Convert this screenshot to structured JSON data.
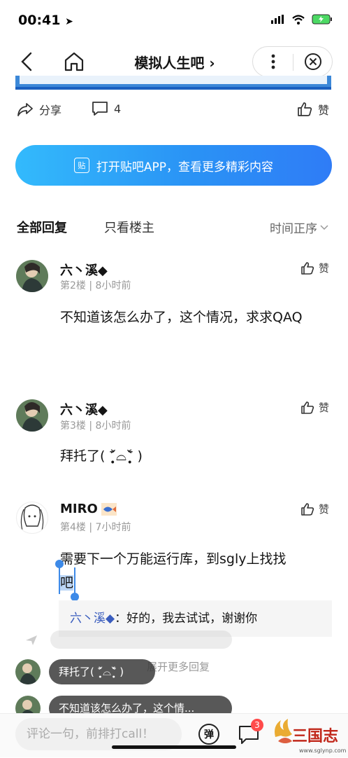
{
  "status_bar": {
    "time": "00:41"
  },
  "header": {
    "title": "模拟人生吧 ›"
  },
  "post_actions": {
    "share_label": "分享",
    "comment_count": "4",
    "like_label": "赞"
  },
  "banner": {
    "icon_text": "贴",
    "text": "打开贴吧APP，查看更多精彩内容"
  },
  "tabs": {
    "all": "全部回复",
    "op_only": "只看楼主",
    "sort": "时间正序"
  },
  "replies": [
    {
      "name": "六丶溪◆",
      "floor": "第2楼",
      "time": "8小时前",
      "content": "不知道该怎么办了，这个情况，求求QAQ",
      "like": "赞"
    },
    {
      "name": "六丶溪◆",
      "floor": "第3楼",
      "time": "8小时前",
      "content": "拜托了( ˃̣̣̥᷄⌓˂̣̣̥᷅ )",
      "like": "赞"
    },
    {
      "name": "MIRO",
      "floor": "第4楼",
      "time": "7小时前",
      "content_line1": "需要下一个万能运行库，到sgly上找找",
      "content_selected": "吧",
      "like": "赞"
    }
  ],
  "sub_reply": {
    "author": "六丶溪◆",
    "text": "：好的，我去试试，谢谢你"
  },
  "danmaku": [
    {
      "text": "拜托了( ˃̣̣̥᷄⌓˂̣̣̥᷅ )"
    },
    {
      "text": "不知道该怎么办了，这个情..."
    }
  ],
  "more_replies": "展开更多回复",
  "bottom_bar": {
    "placeholder": "评论一句，前排打call！",
    "danmaku_label": "弹",
    "comment_badge": "3"
  },
  "watermark": {
    "text": "三国志",
    "url": "www.sglynp.com"
  },
  "colors": {
    "accent": "#2a93f5",
    "link": "#3a5dbe",
    "badge": "#ff4a4a"
  }
}
